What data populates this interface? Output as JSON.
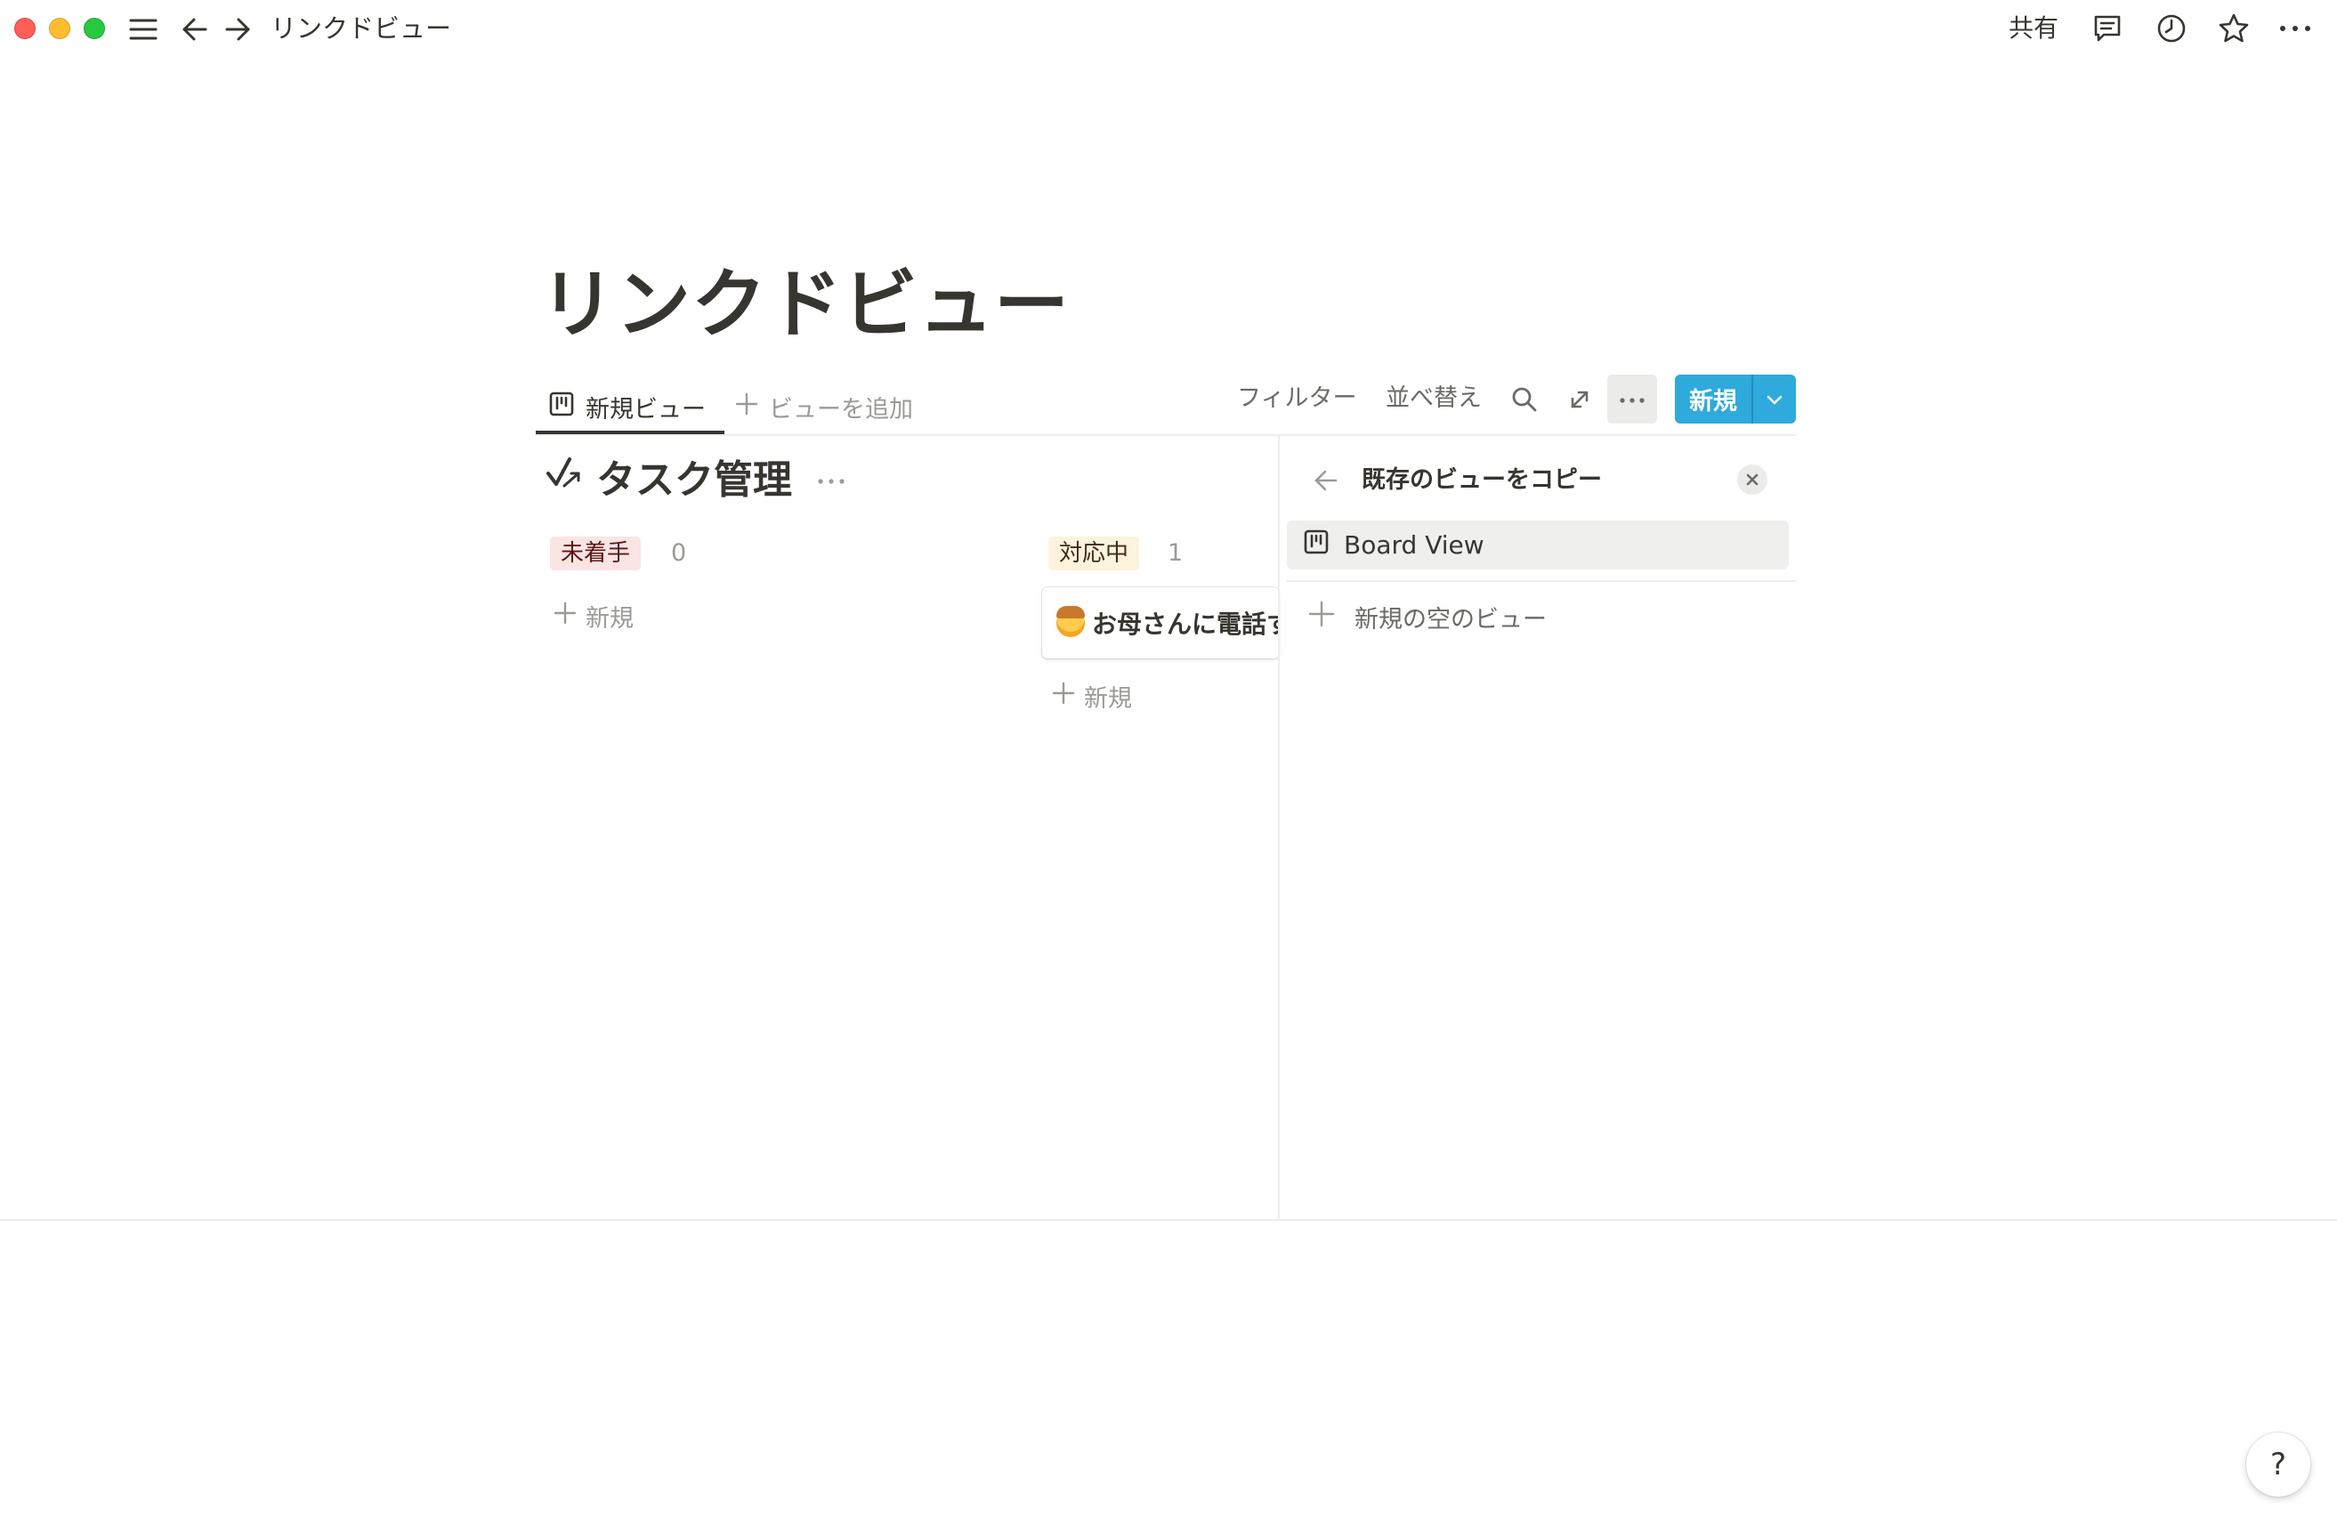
{
  "titlebar": {
    "breadcrumb": "リンクドビュー",
    "share_label": "共有",
    "icons": [
      "sidebar-menu-icon",
      "back-arrow-icon",
      "forward-arrow-icon",
      "comment-icon",
      "clock-icon",
      "star-icon",
      "more-icon"
    ]
  },
  "page": {
    "title": "リンクドビュー"
  },
  "views": {
    "active_tab": "新規ビュー",
    "add_view": "ビューを追加"
  },
  "toolbar": {
    "filter": "フィルター",
    "sort": "並べ替え",
    "new_button": "新規"
  },
  "database": {
    "title": "タスク管理",
    "groups": [
      {
        "label": "未着手",
        "count": "0",
        "add_label": "新規",
        "color": "#fbe4e4"
      },
      {
        "label": "対応中",
        "count": "1",
        "add_label": "新規",
        "color": "#fbf3db",
        "cards": [
          {
            "title": "お母さんに電話す"
          }
        ]
      }
    ]
  },
  "side_panel": {
    "title": "既存のビューをコピー",
    "items": [
      {
        "label": "Board View",
        "icon": "board-view-icon"
      }
    ],
    "new_empty_view": "新規の空のビュー"
  },
  "help": {
    "label": "?"
  },
  "colors": {
    "accent": "#2eaadc",
    "text": "#37352f",
    "muted": "#9b9a97"
  }
}
